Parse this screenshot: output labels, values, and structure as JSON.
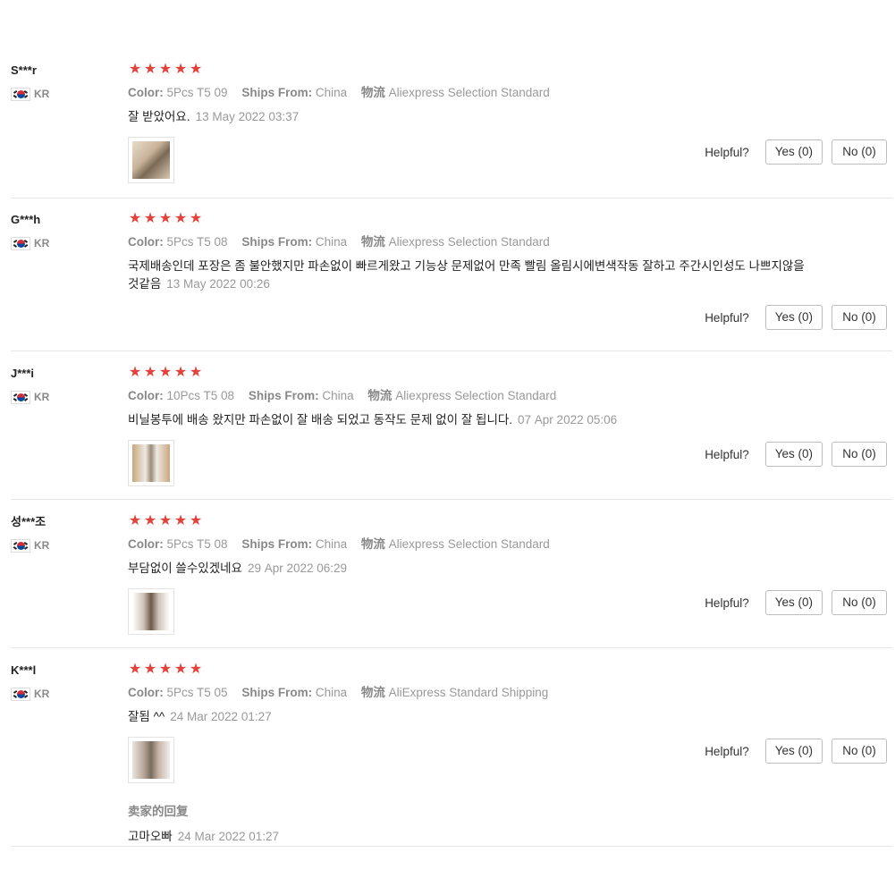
{
  "labels": {
    "color": "Color:",
    "ships_from": "Ships From:",
    "logistics": "物流",
    "helpful": "Helpful?",
    "seller_reply": "卖家的回复"
  },
  "reviews": [
    {
      "user": "S***r",
      "country": "KR",
      "stars": 5,
      "color": "5Pcs T5 09",
      "ships_from": "China",
      "shipping": "Aliexpress Selection Standard",
      "text": "잘 받았어요.",
      "date": "13 May 2022 03:37",
      "yes": "Yes (0)",
      "no": "No (0)"
    },
    {
      "user": "G***h",
      "country": "KR",
      "stars": 5,
      "color": "5Pcs T5 08",
      "ships_from": "China",
      "shipping": "Aliexpress Selection Standard",
      "text": "국제배송인데 포장은 좀 불안했지만 파손없이 빠르게왔고 기능상 문제없어 만족 빨림 올림시에변색작동 잘하고 주간시인성도 나쁘지않을것같음",
      "date": "13 May 2022 00:26",
      "yes": "Yes (0)",
      "no": "No (0)"
    },
    {
      "user": "J***i",
      "country": "KR",
      "stars": 5,
      "color": "10Pcs T5 08",
      "ships_from": "China",
      "shipping": "Aliexpress Selection Standard",
      "text": "비닐봉투에 배송 왔지만 파손없이 잘 배송 되었고 동작도 문제 없이 잘 됩니다.",
      "date": "07 Apr 2022 05:06",
      "yes": "Yes (0)",
      "no": "No (0)"
    },
    {
      "user": "성***조",
      "country": "KR",
      "stars": 5,
      "color": "5Pcs T5 08",
      "ships_from": "China",
      "shipping": "Aliexpress Selection Standard",
      "text": "부담없이 쓸수있겠네요",
      "date": "29 Apr 2022 06:29",
      "yes": "Yes (0)",
      "no": "No (0)"
    },
    {
      "user": "K***l",
      "country": "KR",
      "stars": 5,
      "color": "5Pcs T5 05",
      "ships_from": "China",
      "shipping": "AliExpress Standard Shipping",
      "text": "잘됨 ^^",
      "date": "24 Mar 2022 01:27",
      "yes": "Yes (0)",
      "no": "No (0)",
      "seller_reply_text": "고마오빠",
      "seller_reply_date": "24 Mar 2022 01:27"
    }
  ],
  "colors": {
    "star": "#e3413b",
    "divider": "#e6e6e6"
  }
}
